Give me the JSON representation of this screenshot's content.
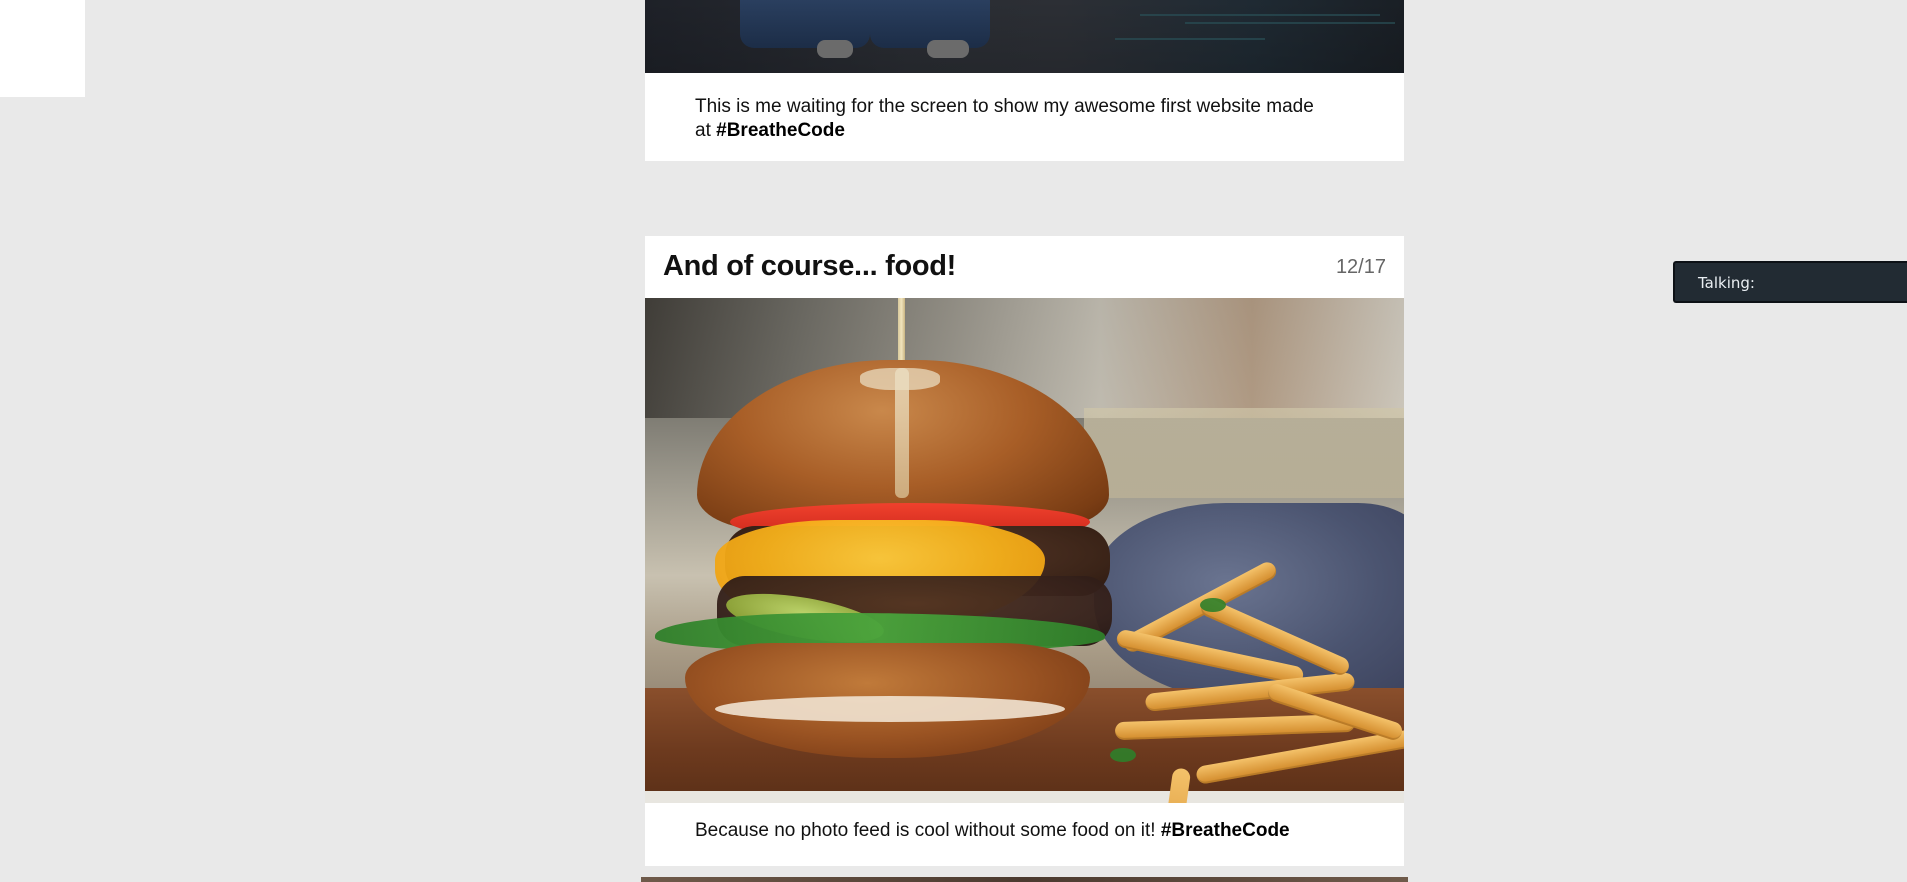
{
  "post1": {
    "caption_text": "This is me waiting for the screen to show my awesome first website made at",
    "hashtag": "#BreatheCode"
  },
  "post2": {
    "title": "And of course... food!",
    "counter": "12/17",
    "caption_text": "Because no photo feed is cool without some food on it!",
    "hashtag": "#BreatheCode"
  },
  "overlay": {
    "talking_label": "Talking:"
  }
}
